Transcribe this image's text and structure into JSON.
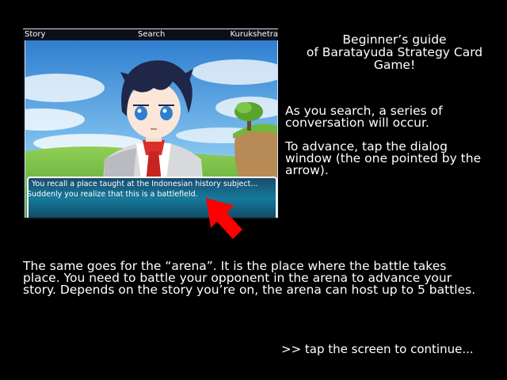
{
  "screenshot": {
    "topbar": {
      "left": "Story",
      "center": "Search",
      "right": "Kurukshetra"
    },
    "dialog": {
      "line1": "You recall a place taught at the Indonesian history subject...",
      "line2": "Suddenly you realize that this is a battlefield."
    }
  },
  "guide": {
    "title_line1": "Beginner’s guide",
    "title_line2": "of Baratayuda Strategy Card",
    "title_line3": "Game!",
    "p1_line1": "As you search, a series of",
    "p1_line2": "conversation will occur.",
    "p2_line1": "To advance, tap the dialog",
    "p2_line2": "window (the one pointed by the",
    "p2_line3": "arrow).",
    "p3_line1": "The same goes for the “arena”. It is the place where the battle takes",
    "p3_line2": "place. You need to battle your opponent in the arena to advance your",
    "p3_line3": "story. Depends on the story you’re on, the arena can host up to 5 battles."
  },
  "continue_prompt": ">> tap the screen to continue...",
  "colors": {
    "background": "#000000",
    "arrow": "#ff0000",
    "text": "#ffffff"
  }
}
